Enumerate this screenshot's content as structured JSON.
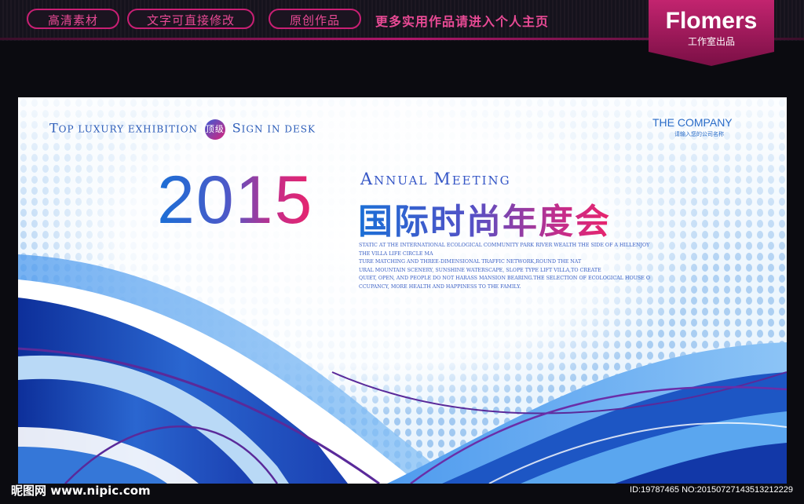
{
  "header": {
    "pills": [
      "高清素材",
      "文字可直接修改",
      "原创作品"
    ],
    "slogan": "更多实用作品请进入个人主页",
    "brand": {
      "name": "Flomers",
      "sub": "工作室出品"
    }
  },
  "banner": {
    "tagline": {
      "part1_cap": "T",
      "part1_rest": "OP LUXURY EXHIBITION",
      "badge": "顶级",
      "part2_cap": "S",
      "part2_rest": "IGN IN DESK"
    },
    "company": "THE COMPANY",
    "company_sub": "请输入您的公司名称",
    "year": "2015",
    "annual": {
      "cap1": "A",
      "rest1": "NNUAL",
      "cap2": "M",
      "rest2": "EETING"
    },
    "title": "国际时尚年度会",
    "paragraph": [
      "STATIC AT THE INTERNATIONAL ECOLOGICAL COMMUNITY PARK RIVER WEALTH THE SIDE OF A HILLENJOY",
      "THE VILLA LIFE CIRCLE MA",
      "TURE MATCHING AND THREE-DIMENSIONAL TRAFFIC NETWORK,ROUND THE NAT",
      "URAL MOUNTAIN SCENERY, SUNSHINE WATERSCAPE, SLOPE TYPE LIFT VILLA,TO CREATE",
      "QUIET, OPEN, AND PEOPLE DO NOT HARASS MANSION BEARING.THE SELECTION OF ECOLOGICAL HOUSE O",
      "CCUPANCY, MORE HEALTH AND HAPPINESS TO THE FAMILY."
    ]
  },
  "footer": {
    "logo": "昵图网 www.nipic.com",
    "id": "ID:19787465 NO:20150727143513212229"
  },
  "colors": {
    "accent_pink": "#e94a95",
    "brand_magenta": "#b0176a",
    "primary_blue": "#1a6fd6",
    "wave_dark_blue": "#1238a8",
    "wave_purple": "#5a2a9a"
  }
}
